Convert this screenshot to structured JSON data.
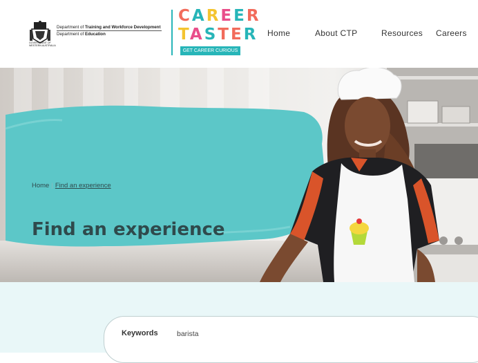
{
  "header": {
    "gov_line1_prefix": "Department of ",
    "gov_line1_strong": "Training and Workforce Development",
    "gov_line2_prefix": "Department of ",
    "gov_line2_strong": "Education",
    "gov_sub_line1": "GOVERNMENT OF",
    "gov_sub_line2": "WESTERN AUSTRALIA",
    "logo": {
      "row1": "CAREER",
      "row2": "TASTER",
      "tagline": "GET CAREER CURIOUS",
      "letter_colors": [
        "#f26b5b",
        "#27b5b8",
        "#f4c430",
        "#e94e8a",
        "#27b5b8",
        "#f26b5b"
      ]
    },
    "nav": [
      "Home",
      "About CTP",
      "Resources",
      "Careers"
    ]
  },
  "hero": {
    "title": "Find an experience",
    "breadcrumb": [
      "Home",
      "Find an experience"
    ],
    "breadcrumb_separator": "|",
    "brush_color": "#5cc7c8"
  },
  "search": {
    "keywords_label": "Keywords",
    "keywords_value": "barista"
  },
  "colors": {
    "accent": "#27b5b8",
    "title_text": "#2f4a4c",
    "search_band": "#e9f7f8"
  }
}
